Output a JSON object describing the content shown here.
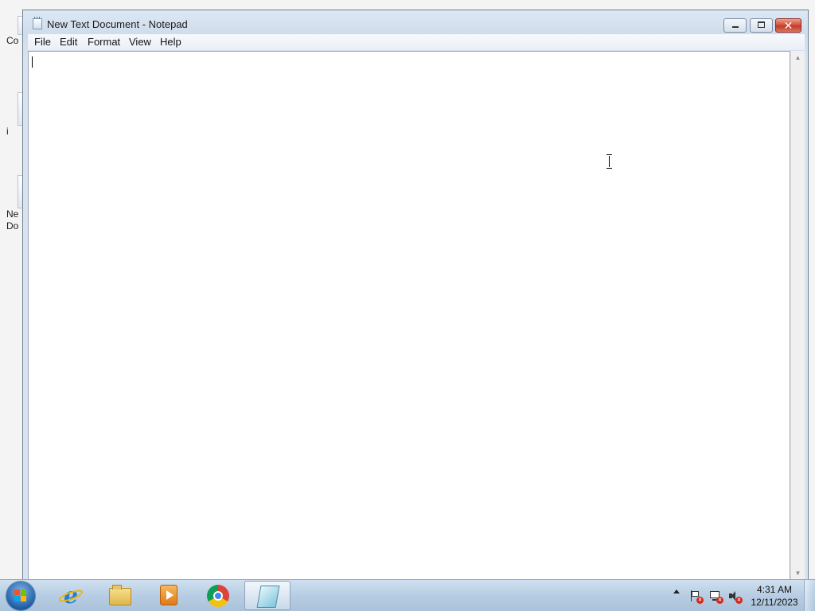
{
  "window": {
    "title": "New Text Document - Notepad",
    "controls": {
      "minimize_icon": "minimize-icon",
      "maximize_icon": "restore-icon",
      "close_glyph": "✕"
    }
  },
  "menu": {
    "file": "File",
    "edit": "Edit",
    "format": "Format",
    "view": "View",
    "help": "Help"
  },
  "editor": {
    "content": ""
  },
  "desktop": {
    "icons": [
      {
        "label": "Co"
      },
      {
        "label": "i"
      },
      {
        "label": "Ne"
      },
      {
        "label": "Do"
      }
    ]
  },
  "taskbar": {
    "apps": [
      {
        "name": "Internet Explorer",
        "icon": "internet-explorer-icon"
      },
      {
        "name": "Windows Explorer",
        "icon": "folder-icon"
      },
      {
        "name": "Windows Media Player",
        "icon": "media-player-icon"
      },
      {
        "name": "Google Chrome",
        "icon": "chrome-icon"
      },
      {
        "name": "Notepad",
        "icon": "notepad-icon",
        "active": true
      }
    ],
    "clock": {
      "time": "4:31 AM",
      "date": "12/11/2023"
    }
  },
  "colors": {
    "close_button": "#c9432f",
    "taskbar": "#b7cde3",
    "editor_background": "#ffffff"
  }
}
